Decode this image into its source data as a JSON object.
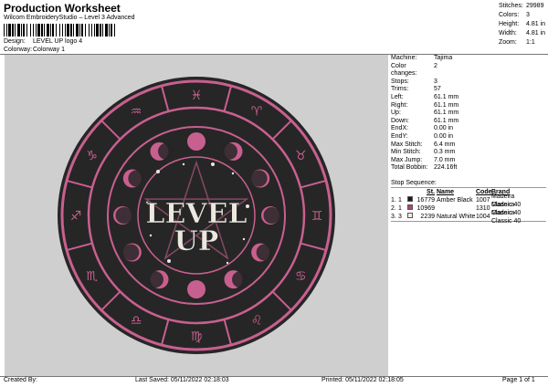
{
  "header": {
    "title": "Production Worksheet",
    "subtitle": "Wilcom EmbroideryStudio – Level 3 Advanced",
    "design_label": "Design:",
    "design_value": "LEVEL UP logo 4",
    "colorway_label": "Colorway:",
    "colorway_value": "Colorway 1"
  },
  "stats": [
    {
      "label": "Stitches:",
      "value": "29989"
    },
    {
      "label": "Colors:",
      "value": "3"
    },
    {
      "label": "Height:",
      "value": "4.81 in"
    },
    {
      "label": "Width:",
      "value": "4.81 in"
    },
    {
      "label": "Zoom:",
      "value": "1:1"
    }
  ],
  "design_preview": {
    "text_line1": "LEVEL",
    "text_line2": "UP",
    "zodiac": [
      "♈",
      "♉",
      "♊",
      "♋",
      "♌",
      "♍",
      "♎",
      "♏",
      "♐",
      "♑",
      "♒",
      "♓"
    ],
    "colors": {
      "background": "#cfcfcf",
      "disk": "#262626",
      "ring": "#c8608f",
      "text": "#ece7df"
    }
  },
  "machine_info": [
    {
      "label": "Machine:",
      "value": "Tajima"
    },
    {
      "label": "Color changes:",
      "value": "2"
    },
    {
      "label": "Stops:",
      "value": "3"
    },
    {
      "label": "Trims:",
      "value": "57"
    },
    {
      "label": "Left:",
      "value": "61.1 mm"
    },
    {
      "label": "Right:",
      "value": "61.1 mm"
    },
    {
      "label": "Up:",
      "value": "61.1 mm"
    },
    {
      "label": "Down:",
      "value": "61.1 mm"
    },
    {
      "label": "EndX:",
      "value": "0.00 in"
    },
    {
      "label": "EndY:",
      "value": "0.00 in"
    },
    {
      "label": "Max Stitch:",
      "value": "6.4 mm"
    },
    {
      "label": "Min Stitch:",
      "value": "0.3 mm"
    },
    {
      "label": "Max Jump:",
      "value": "7.0 mm"
    },
    {
      "label": "Total Bobbin:",
      "value": "224.16ft"
    }
  ],
  "stop_sequence": {
    "title": "Stop Sequence:",
    "columns": {
      "st": "St.",
      "name": "Name",
      "code": "Code",
      "brand": "Brand"
    },
    "rows": [
      {
        "stop": "1.",
        "index": "1",
        "st": "16779",
        "name": "Amber Black",
        "code": "1007",
        "brand": "Madeira Classic 40",
        "color": "#1a1a1a"
      },
      {
        "stop": "2.",
        "index": "1",
        "st": "10969",
        "name": "",
        "code": "1310",
        "brand": "Madeira Classic 40",
        "color": "#b0447d"
      },
      {
        "stop": "3.",
        "index": "3",
        "st": "2239",
        "name": "Natural White",
        "code": "1004",
        "brand": "Madeira Classic 40",
        "color": "#f1eee6"
      }
    ]
  },
  "footer": {
    "created_by": "Created By:",
    "last_saved": "Last Saved: 05/11/2022 02:18:03",
    "printed": "Printed: 05/11/2022 02:18:05",
    "page": "Page 1 of 1"
  }
}
